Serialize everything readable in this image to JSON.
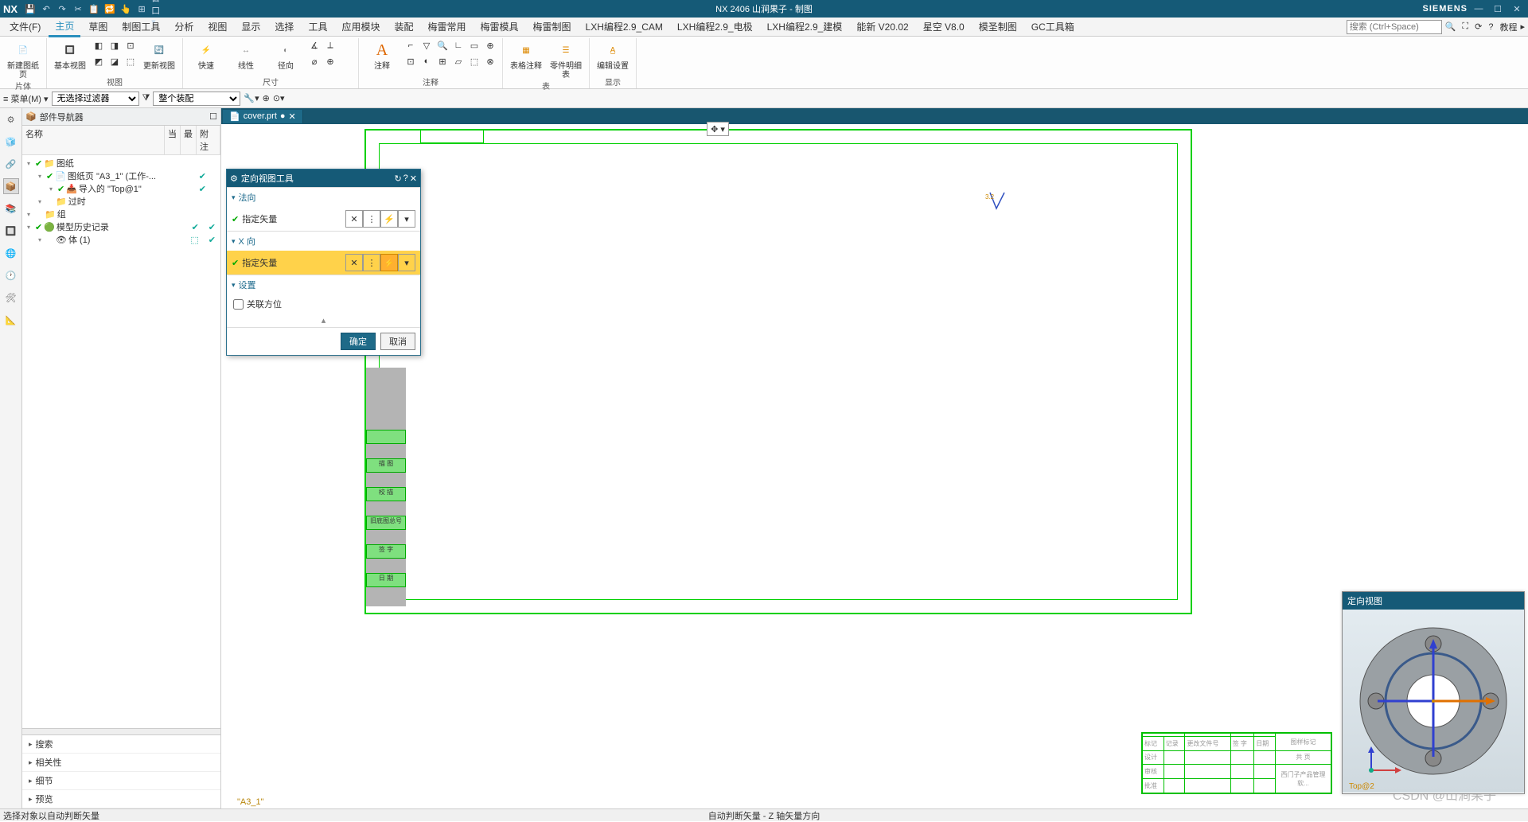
{
  "titlebar": {
    "logo": "NX",
    "title": "NX 2406 山涧果子 - 制图",
    "brand": "SIEMENS"
  },
  "menu": {
    "items": [
      "文件(F)",
      "主页",
      "草图",
      "制图工具",
      "分析",
      "视图",
      "显示",
      "选择",
      "工具",
      "应用模块",
      "装配",
      "梅雷常用",
      "梅雷模具",
      "梅雷制图",
      "LXH编程2.9_CAM",
      "LXH编程2.9_电极",
      "LXH编程2.9_建模",
      "能新 V20.02",
      "星空 V8.0",
      "模圣制图",
      "GC工具箱"
    ],
    "active_index": 1,
    "search_placeholder": "搜索 (Ctrl+Space)",
    "tutorial": "教程"
  },
  "ribbon": {
    "groups": [
      {
        "label": "片体",
        "big": [
          {
            "l1": "新建图纸页"
          }
        ]
      },
      {
        "label": "视图",
        "big": [
          {
            "l1": "基本视图"
          },
          {
            "l1": "更新视图"
          }
        ]
      },
      {
        "label": "",
        "big": [
          {
            "l1": "快速"
          },
          {
            "l1": "线性"
          },
          {
            "l1": "径向"
          }
        ]
      },
      {
        "label": "尺寸",
        "big": []
      },
      {
        "label": "注释",
        "big": [
          {
            "l1": "注释"
          }
        ]
      },
      {
        "label": "",
        "big": []
      },
      {
        "label": "表",
        "big": [
          {
            "l1": "表格注释"
          },
          {
            "l1": "零件明细表"
          }
        ]
      },
      {
        "label": "显示",
        "big": [
          {
            "l1": "编辑设置"
          }
        ]
      }
    ]
  },
  "filterbar": {
    "menu_label": "菜单(M)",
    "filter1": "无选择过滤器",
    "filter2": "整个装配"
  },
  "nav": {
    "title": "部件导航器",
    "cols": [
      "名称",
      "当",
      "最",
      "附注"
    ],
    "tree": [
      {
        "indent": 0,
        "chk": true,
        "icon": "📁",
        "text": "图纸",
        "m1": "",
        "m2": ""
      },
      {
        "indent": 1,
        "chk": true,
        "icon": "📄",
        "text": "图纸页 \"A3_1\" (工作-...",
        "m1": "✔",
        "m2": ""
      },
      {
        "indent": 2,
        "chk": true,
        "icon": "📥",
        "text": "导入的 \"Top@1\"",
        "m1": "✔",
        "m2": ""
      },
      {
        "indent": 1,
        "chk": false,
        "icon": "📁",
        "text": "过时",
        "m1": "",
        "m2": ""
      },
      {
        "indent": 0,
        "chk": false,
        "icon": "📁",
        "text": "组",
        "m1": "",
        "m2": ""
      },
      {
        "indent": 0,
        "chk": true,
        "icon": "🟢",
        "text": "模型历史记录",
        "m1": "✔",
        "m2": "✔"
      },
      {
        "indent": 1,
        "chk": false,
        "icon": "👁",
        "text": "体 (1)",
        "m1": "⬚",
        "m2": "✔"
      }
    ],
    "accordion": [
      "搜索",
      "相关性",
      "细节",
      "预览"
    ]
  },
  "tab": {
    "file": "cover.prt",
    "dirty": "●"
  },
  "dialog": {
    "title": "定向视图工具",
    "sec1": "法向",
    "sec1_item": "指定矢量",
    "sec2": "X 向",
    "sec2_item": "指定矢量",
    "sec3": "设置",
    "assoc": "关联方位",
    "ok": "确定",
    "cancel": "取消"
  },
  "orient": {
    "title": "定向视图",
    "toplabel": "Top@2"
  },
  "titleblock": {
    "r1": [
      "标记",
      "记录",
      "更改文件号",
      "签 字",
      "日期"
    ],
    "r2": "设计",
    "r3": "审核",
    "r4": "批准",
    "scale_label": "图样标记",
    "sheets": "共    页",
    "product": "西门子产品管理软..."
  },
  "sheetlabel": "\"A3_1\"",
  "status": {
    "left": "选择对象以自动判断矢量",
    "center": "自动判断矢量 - Z 轴矢量方向"
  },
  "watermark": "CSDN @山涧果子",
  "surface_mark": "3.2"
}
